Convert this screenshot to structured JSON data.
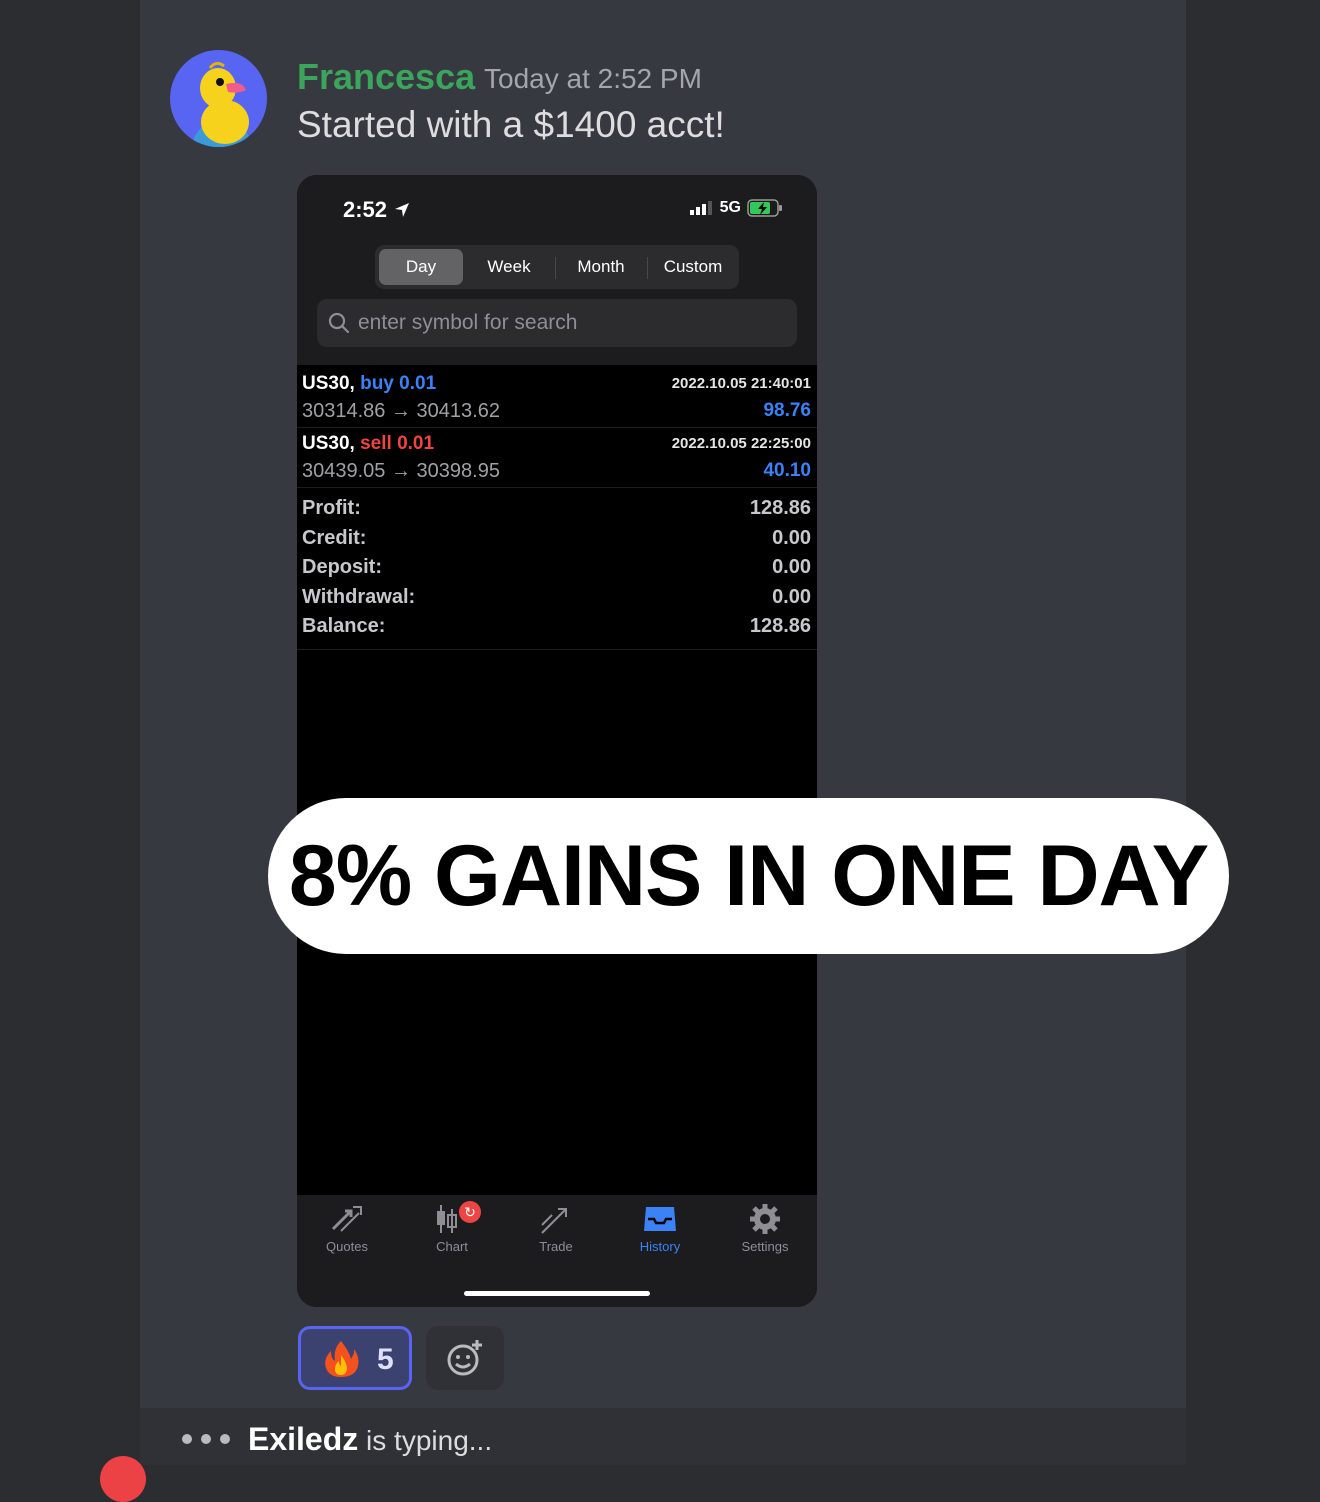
{
  "message": {
    "username": "Francesca",
    "timestamp": "Today at 2:52 PM",
    "text": "Started with a $1400 acct!"
  },
  "phone": {
    "status": {
      "time": "2:52",
      "network": "5G"
    },
    "segments": [
      "Day",
      "Week",
      "Month",
      "Custom"
    ],
    "active_segment": "Day",
    "search_placeholder": "enter symbol for search",
    "trades": [
      {
        "symbol": "US30,",
        "side": "buy 0.01",
        "prices": "30314.86 → 30413.62",
        "datetime": "2022.10.05 21:40:01",
        "profit": "98.76"
      },
      {
        "symbol": "US30,",
        "side": "sell 0.01",
        "prices": "30439.05 → 30398.95",
        "datetime": "2022.10.05 22:25:00",
        "profit": "40.10"
      }
    ],
    "summary": [
      {
        "label": "Profit:",
        "value": "128.86"
      },
      {
        "label": "Credit:",
        "value": "0.00"
      },
      {
        "label": "Deposit:",
        "value": "0.00"
      },
      {
        "label": "Withdrawal:",
        "value": "0.00"
      },
      {
        "label": "Balance:",
        "value": "128.86"
      }
    ],
    "tabs": [
      "Quotes",
      "Chart",
      "Trade",
      "History",
      "Settings"
    ],
    "active_tab": "History"
  },
  "banner": {
    "text": "8% GAINS IN ONE DAY"
  },
  "reactions": {
    "fire_count": "5"
  },
  "typing": {
    "user": "Exiledz",
    "suffix": "is typing..."
  },
  "colors": {
    "username": "#3ba55c",
    "buy": "#3b82f6",
    "sell": "#ef4444",
    "reaction_border": "#5865f2",
    "chat_bg": "#36393f"
  }
}
